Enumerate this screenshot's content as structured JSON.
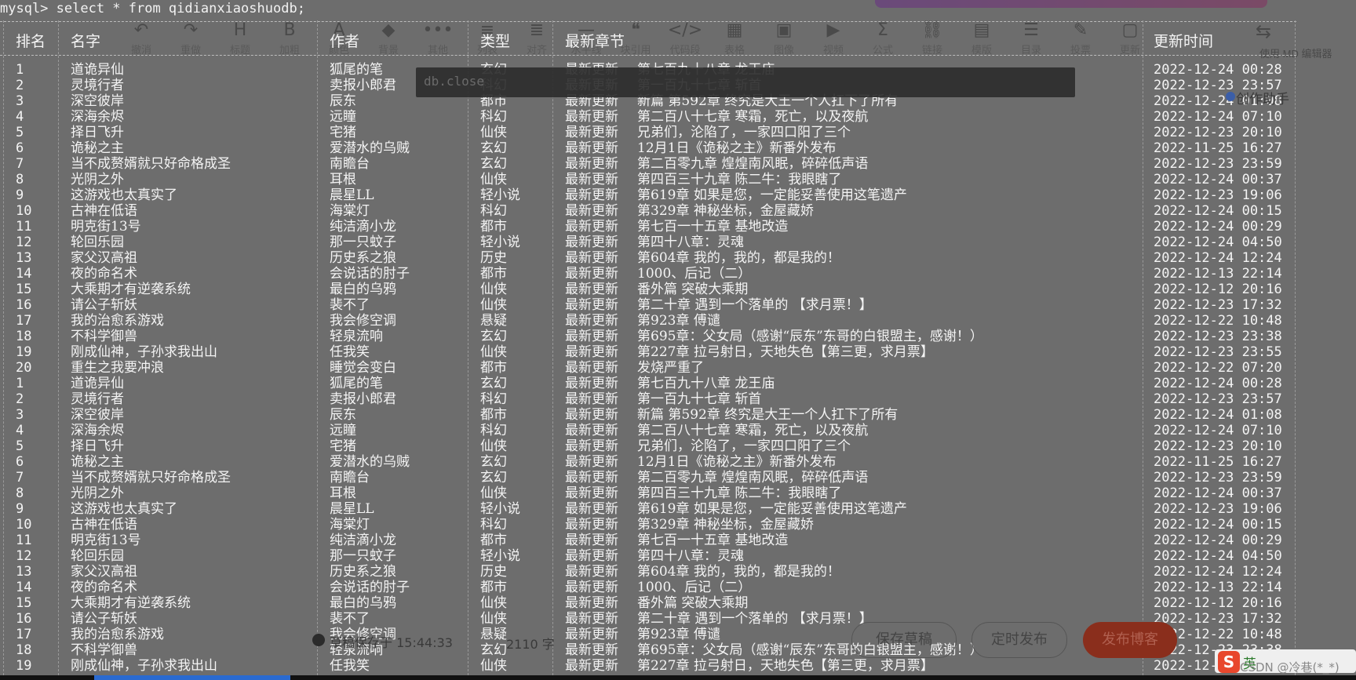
{
  "terminal": {
    "prompt": "mysql> select * from qidianxiaoshuodb;",
    "popup_text": "db.close"
  },
  "toolbar": {
    "items": [
      {
        "icon": "↶",
        "label": "撤消"
      },
      {
        "icon": "↷",
        "label": "重做"
      },
      {
        "icon": "H",
        "label": "标题"
      },
      {
        "icon": "B",
        "label": "加粗"
      },
      {
        "icon": "A",
        "label": "颜色"
      },
      {
        "icon": "◆",
        "label": "背景"
      },
      {
        "icon": "•••",
        "label": "其他"
      },
      {
        "icon": "≡",
        "label": "列表"
      },
      {
        "icon": "≣",
        "label": "对齐"
      },
      {
        "icon": "—",
        "label": "水平线"
      },
      {
        "icon": "❝",
        "label": "块引用"
      },
      {
        "icon": "</>",
        "label": "代码段"
      },
      {
        "icon": "▦",
        "label": "表格"
      },
      {
        "icon": "▣",
        "label": "图像"
      },
      {
        "icon": "▶",
        "label": "视频"
      },
      {
        "icon": "Σ",
        "label": "公式"
      },
      {
        "icon": "⛓",
        "label": "链接"
      },
      {
        "icon": "▤",
        "label": "模版"
      },
      {
        "icon": "☰",
        "label": "目录"
      },
      {
        "icon": "✎",
        "label": "投票"
      },
      {
        "icon": "▢",
        "label": "更新"
      }
    ],
    "md_label": "使用 MD 编辑器",
    "md_icon": "⇆"
  },
  "table": {
    "headers": {
      "rank": "排名",
      "name": "名字",
      "author": "作者",
      "type": "类型",
      "chapter": "最新章节",
      "time": "更新时间"
    },
    "rows": [
      {
        "rank": "1",
        "name": "道诡异仙",
        "author": "狐尾的笔",
        "type": "玄幻",
        "status": "最新更新",
        "chapter": "第七百九十八章 龙王庙",
        "time": "2022-12-24 00:28"
      },
      {
        "rank": "2",
        "name": "灵境行者",
        "author": "卖报小郎君",
        "type": "科幻",
        "status": "最新更新",
        "chapter": "第一百九十七章 斩首",
        "time": "2022-12-23 23:57"
      },
      {
        "rank": "3",
        "name": "深空彼岸",
        "author": "辰东",
        "type": "都市",
        "status": "最新更新",
        "chapter": "新篇 第592章 终究是大王一个人扛下了所有",
        "time": "2022-12-24 01:08"
      },
      {
        "rank": "4",
        "name": "深海余烬",
        "author": "远瞳",
        "type": "科幻",
        "status": "最新更新",
        "chapter": "第二百八十七章 寒霜，死亡，以及夜航",
        "time": "2022-12-24 07:10"
      },
      {
        "rank": "5",
        "name": "择日飞升",
        "author": "宅猪",
        "type": "仙侠",
        "status": "最新更新",
        "chapter": "兄弟们，沦陷了，一家四口阳了三个",
        "time": "2022-12-23 20:10"
      },
      {
        "rank": "6",
        "name": "诡秘之主",
        "author": "爱潜水的乌贼",
        "type": "玄幻",
        "status": "最新更新",
        "chapter": "12月1日《诡秘之主》新番外发布",
        "time": "2022-11-25 16:27"
      },
      {
        "rank": "7",
        "name": "当不成赘婿就只好命格成圣",
        "author": "南瞻台",
        "type": "玄幻",
        "status": "最新更新",
        "chapter": "第二百零九章 煌煌南风眠，碎碎低声语",
        "time": "2022-12-23 23:59"
      },
      {
        "rank": "8",
        "name": "光阴之外",
        "author": "耳根",
        "type": "仙侠",
        "status": "最新更新",
        "chapter": "第四百三十九章 陈二牛：我眼瞎了",
        "time": "2022-12-24 00:37"
      },
      {
        "rank": "9",
        "name": "这游戏也太真实了",
        "author": "晨星LL",
        "type": "轻小说",
        "status": "最新更新",
        "chapter": "第619章 如果是您，一定能妥善使用这笔遗产",
        "time": "2022-12-23 19:06"
      },
      {
        "rank": "10",
        "name": "古神在低语",
        "author": "海棠灯",
        "type": "科幻",
        "status": "最新更新",
        "chapter": "第329章 神秘坐标，金屋藏娇",
        "time": "2022-12-24 00:15"
      },
      {
        "rank": "11",
        "name": "明克街13号",
        "author": "纯洁滴小龙",
        "type": "都市",
        "status": "最新更新",
        "chapter": "第七百一十五章 基地改造",
        "time": "2022-12-24 00:29"
      },
      {
        "rank": "12",
        "name": "轮回乐园",
        "author": "那一只蚊子",
        "type": "轻小说",
        "status": "最新更新",
        "chapter": "第四十八章：灵魂",
        "time": "2022-12-24 04:50"
      },
      {
        "rank": "13",
        "name": "家父汉高祖",
        "author": "历史系之狼",
        "type": "历史",
        "status": "最新更新",
        "chapter": "第604章 我的，我的，都是我的！",
        "time": "2022-12-24 12:24"
      },
      {
        "rank": "14",
        "name": "夜的命名术",
        "author": "会说话的肘子",
        "type": "都市",
        "status": "最新更新",
        "chapter": "1000、后记（二）",
        "time": "2022-12-13 22:14"
      },
      {
        "rank": "15",
        "name": "大乘期才有逆袭系统",
        "author": "最白的乌鸦",
        "type": "仙侠",
        "status": "最新更新",
        "chapter": "番外篇 突破大乘期",
        "time": "2022-12-12 20:16"
      },
      {
        "rank": "16",
        "name": "请公子斩妖",
        "author": "裴不了",
        "type": "仙侠",
        "status": "最新更新",
        "chapter": "第二十章 遇到一个落单的 【求月票！】",
        "time": "2022-12-23 17:32"
      },
      {
        "rank": "17",
        "name": "我的治愈系游戏",
        "author": "我会修空调",
        "type": "悬疑",
        "status": "最新更新",
        "chapter": "第923章 傅谴",
        "time": "2022-12-22 10:48"
      },
      {
        "rank": "18",
        "name": "不科学御兽",
        "author": "轻泉流响",
        "type": "玄幻",
        "status": "最新更新",
        "chapter": "第695章：父女局（感谢“辰东”东哥的白银盟主，感谢！）",
        "time": "2022-12-23 23:38"
      },
      {
        "rank": "19",
        "name": "刚成仙神，子孙求我出山",
        "author": "任我笑",
        "type": "仙侠",
        "status": "最新更新",
        "chapter": "第227章 拉弓射日，天地失色【第三更，求月票】",
        "time": "2022-12-23 23:55"
      },
      {
        "rank": "20",
        "name": "重生之我要冲浪",
        "author": "睡觉会变白",
        "type": "都市",
        "status": "最新更新",
        "chapter": "发烧严重了",
        "time": "2022-12-22 07:20"
      },
      {
        "rank": "1",
        "name": "道诡异仙",
        "author": "狐尾的笔",
        "type": "玄幻",
        "status": "最新更新",
        "chapter": "第七百九十八章 龙王庙",
        "time": "2022-12-24 00:28"
      },
      {
        "rank": "2",
        "name": "灵境行者",
        "author": "卖报小郎君",
        "type": "科幻",
        "status": "最新更新",
        "chapter": "第一百九十七章 斩首",
        "time": "2022-12-23 23:57"
      },
      {
        "rank": "3",
        "name": "深空彼岸",
        "author": "辰东",
        "type": "都市",
        "status": "最新更新",
        "chapter": "新篇 第592章 终究是大王一个人扛下了所有",
        "time": "2022-12-24 01:08"
      },
      {
        "rank": "4",
        "name": "深海余烬",
        "author": "远瞳",
        "type": "科幻",
        "status": "最新更新",
        "chapter": "第二百八十七章 寒霜，死亡，以及夜航",
        "time": "2022-12-24 07:10"
      },
      {
        "rank": "5",
        "name": "择日飞升",
        "author": "宅猪",
        "type": "仙侠",
        "status": "最新更新",
        "chapter": "兄弟们，沦陷了，一家四口阳了三个",
        "time": "2022-12-23 20:10"
      },
      {
        "rank": "6",
        "name": "诡秘之主",
        "author": "爱潜水的乌贼",
        "type": "玄幻",
        "status": "最新更新",
        "chapter": "12月1日《诡秘之主》新番外发布",
        "time": "2022-11-25 16:27"
      },
      {
        "rank": "7",
        "name": "当不成赘婿就只好命格成圣",
        "author": "南瞻台",
        "type": "玄幻",
        "status": "最新更新",
        "chapter": "第二百零九章 煌煌南风眠，碎碎低声语",
        "time": "2022-12-23 23:59"
      },
      {
        "rank": "8",
        "name": "光阴之外",
        "author": "耳根",
        "type": "仙侠",
        "status": "最新更新",
        "chapter": "第四百三十九章 陈二牛：我眼瞎了",
        "time": "2022-12-24 00:37"
      },
      {
        "rank": "9",
        "name": "这游戏也太真实了",
        "author": "晨星LL",
        "type": "轻小说",
        "status": "最新更新",
        "chapter": "第619章 如果是您，一定能妥善使用这笔遗产",
        "time": "2022-12-23 19:06"
      },
      {
        "rank": "10",
        "name": "古神在低语",
        "author": "海棠灯",
        "type": "科幻",
        "status": "最新更新",
        "chapter": "第329章 神秘坐标，金屋藏娇",
        "time": "2022-12-24 00:15"
      },
      {
        "rank": "11",
        "name": "明克街13号",
        "author": "纯洁滴小龙",
        "type": "都市",
        "status": "最新更新",
        "chapter": "第七百一十五章 基地改造",
        "time": "2022-12-24 00:29"
      },
      {
        "rank": "12",
        "name": "轮回乐园",
        "author": "那一只蚊子",
        "type": "轻小说",
        "status": "最新更新",
        "chapter": "第四十八章：灵魂",
        "time": "2022-12-24 04:50"
      },
      {
        "rank": "13",
        "name": "家父汉高祖",
        "author": "历史系之狼",
        "type": "历史",
        "status": "最新更新",
        "chapter": "第604章 我的，我的，都是我的！",
        "time": "2022-12-24 12:24"
      },
      {
        "rank": "14",
        "name": "夜的命名术",
        "author": "会说话的肘子",
        "type": "都市",
        "status": "最新更新",
        "chapter": "1000、后记（二）",
        "time": "2022-12-13 22:14"
      },
      {
        "rank": "15",
        "name": "大乘期才有逆袭系统",
        "author": "最白的乌鸦",
        "type": "仙侠",
        "status": "最新更新",
        "chapter": "番外篇 突破大乘期",
        "time": "2022-12-12 20:16"
      },
      {
        "rank": "16",
        "name": "请公子斩妖",
        "author": "裴不了",
        "type": "仙侠",
        "status": "最新更新",
        "chapter": "第二十章 遇到一个落单的 【求月票！】",
        "time": "2022-12-23 17:32"
      },
      {
        "rank": "17",
        "name": "我的治愈系游戏",
        "author": "我会修空调",
        "type": "悬疑",
        "status": "最新更新",
        "chapter": "第923章 傅谴",
        "time": "2022-12-22 10:48"
      },
      {
        "rank": "18",
        "name": "不科学御兽",
        "author": "轻泉流响",
        "type": "玄幻",
        "status": "最新更新",
        "chapter": "第695章：父女局（感谢“辰东”东哥的白银盟主，感谢！）",
        "time": "2022-12-23 23:38"
      },
      {
        "rank": "19",
        "name": "刚成仙神，子孙求我出山",
        "author": "任我笑",
        "type": "仙侠",
        "status": "最新更新",
        "chapter": "第227章 拉弓射日，天地失色【第三更，求月票】",
        "time": "2022-12-"
      }
    ]
  },
  "assistant": {
    "label": "创作助手"
  },
  "footer": {
    "save_status": "草稿保存于 15:44:33",
    "word_count": "2110 字",
    "draft_label": "保存草稿",
    "schedule_label": "定时发布",
    "publish_label": "发布博客",
    "ime_logo": "S",
    "ime_lang": "英",
    "watermark": "CSDN @冷巷(*_*)"
  },
  "colors": {
    "background": "#6d6d6d",
    "text": "#f4f4f4",
    "publish": "#8a2e1c"
  }
}
